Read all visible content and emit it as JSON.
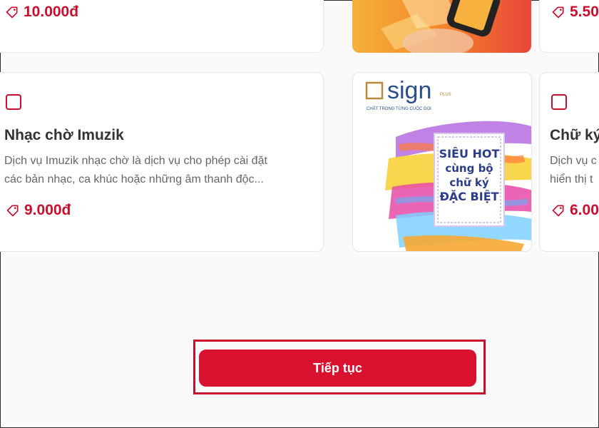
{
  "colors": {
    "accent": "#d9112f",
    "price": "#c8102e",
    "title": "#333333",
    "description": "#666666"
  },
  "top_row": {
    "left_price": "10.000đ",
    "right_price": "5.50"
  },
  "cards": [
    {
      "title": "Nhạc chờ Imuzik",
      "description_line1": "Dịch vụ Imuzik nhạc chờ là dịch vụ cho phép cài đặt",
      "description_line2": "các bản nhạc, ca khúc hoặc những âm thanh độc...",
      "price": "9.000đ",
      "icon": "tag-icon"
    },
    {
      "title": "Chữ ký",
      "description_line1": "Dịch vụ c",
      "description_line2": "hiển thị t",
      "price": "6.00",
      "icon": "tag-icon"
    }
  ],
  "promo_image": {
    "logo_text": "sign",
    "logo_plus": "PLUS",
    "tagline": "CHẤT TRONG TỪNG CUỘC GỌI",
    "headline_line1": "SIÊU HOT",
    "headline_line2": "cùng bộ",
    "headline_line3": "chữ ký",
    "headline_line4": "ĐẶC BIỆT"
  },
  "continue_button": {
    "label": "Tiếp tục"
  }
}
